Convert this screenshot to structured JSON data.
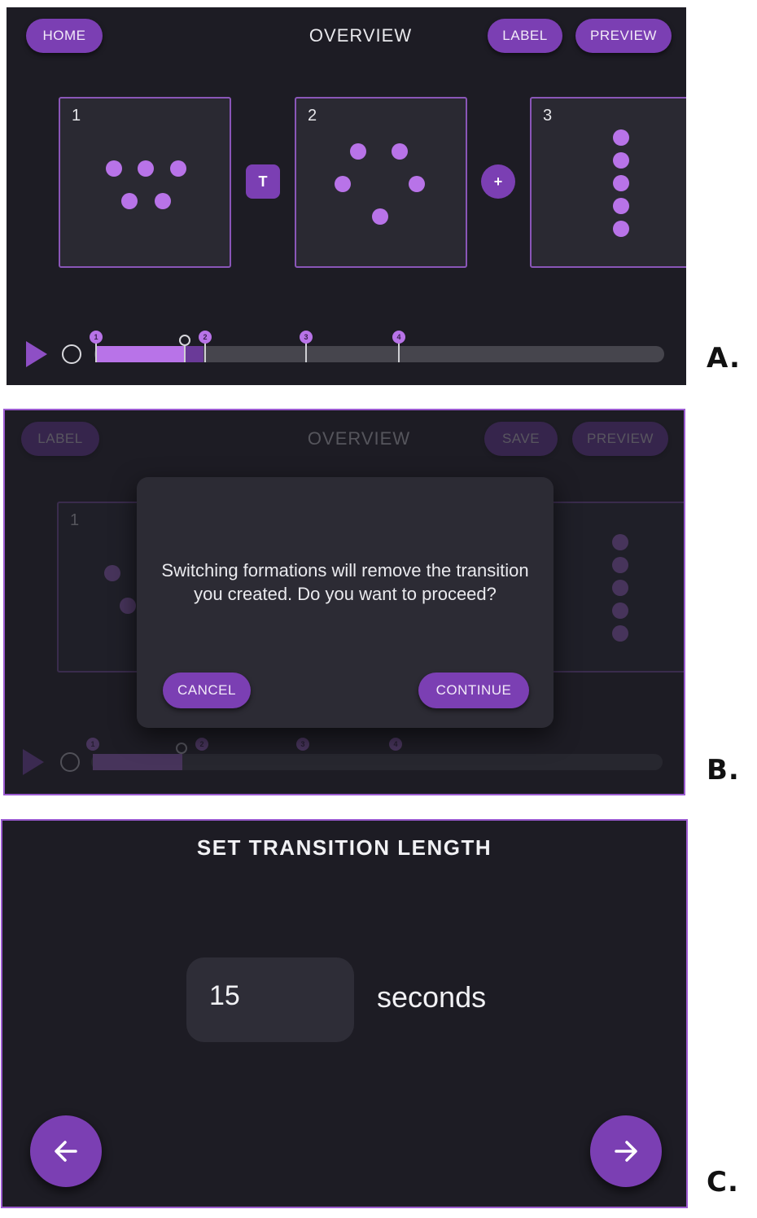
{
  "panel_a": {
    "letter": "A.",
    "home_label": "HOME",
    "title": "OVERVIEW",
    "label_label": "LABEL",
    "preview_label": "PREVIEW",
    "formations": [
      {
        "number": "1"
      },
      {
        "number": "2"
      },
      {
        "number": "3"
      }
    ],
    "transition_button": "T",
    "add_button": "+",
    "timeline_markers": [
      "1",
      "2",
      "3",
      "4"
    ]
  },
  "panel_b": {
    "letter": "B.",
    "label_label": "LABEL",
    "title": "OVERVIEW",
    "save_label": "SAVE",
    "preview_label": "PREVIEW",
    "formation_number": "1",
    "timeline_markers": [
      "1",
      "2",
      "3",
      "4"
    ],
    "dialog": {
      "message": "Switching formations will remove the transition you created. Do you want to proceed?",
      "cancel_label": "CANCEL",
      "continue_label": "CONTINUE"
    }
  },
  "panel_c": {
    "letter": "C.",
    "title": "SET TRANSITION LENGTH",
    "value": "15",
    "unit": "seconds",
    "back_icon": "arrow-left-icon",
    "next_icon": "arrow-right-icon"
  },
  "colors": {
    "background": "#1d1c24",
    "accent": "#7b3fb3",
    "dot": "#b873e8",
    "border": "#9b5bd0"
  }
}
